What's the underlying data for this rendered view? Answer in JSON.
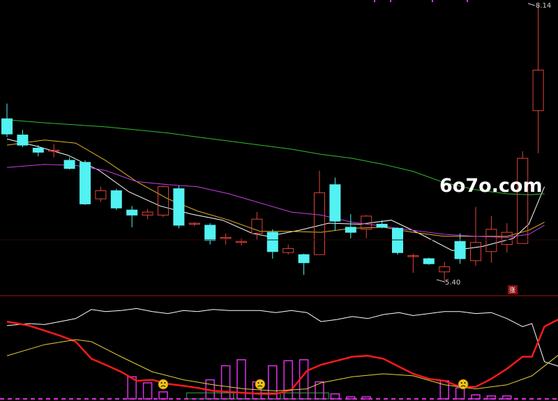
{
  "watermark": "6o7o.com",
  "price_labels": {
    "high": "8.14",
    "low": "5.40"
  },
  "limit_badge": "涨",
  "colors": {
    "background": "#000000",
    "up": "#e0433a",
    "down": "#52f2f2",
    "ma5": "#ffffff",
    "ma10": "#e6b422",
    "ma30": "#c83ee8",
    "ma60": "#2fbf2f",
    "divider": "#b01010",
    "osc_white": "#ffffff",
    "osc_red": "#ff1a1a",
    "osc_yellow": "#e6d23a",
    "bar_magenta": "#e030e8",
    "bar_green": "#3aa04a",
    "face": "#f2c316"
  },
  "chart_data": [
    {
      "type": "candlestick",
      "y_range_estimated": [
        5.1,
        8.3
      ],
      "candles": [
        {
          "o": 7.02,
          "h": 7.17,
          "l": 6.84,
          "c": 6.87
        },
        {
          "o": 6.86,
          "h": 6.91,
          "l": 6.74,
          "c": 6.76
        },
        {
          "o": 6.73,
          "h": 6.76,
          "l": 6.65,
          "c": 6.69
        },
        {
          "o": 6.71,
          "h": 6.77,
          "l": 6.64,
          "c": 6.71
        },
        {
          "o": 6.61,
          "h": 6.64,
          "l": 6.52,
          "c": 6.53
        },
        {
          "o": 6.59,
          "h": 6.61,
          "l": 6.17,
          "c": 6.18
        },
        {
          "o": 6.23,
          "h": 6.35,
          "l": 6.2,
          "c": 6.31
        },
        {
          "o": 6.31,
          "h": 6.33,
          "l": 6.12,
          "c": 6.14
        },
        {
          "o": 6.12,
          "h": 6.16,
          "l": 5.95,
          "c": 6.07
        },
        {
          "o": 6.07,
          "h": 6.13,
          "l": 6.03,
          "c": 6.1
        },
        {
          "o": 6.07,
          "h": 6.36,
          "l": 6.05,
          "c": 6.35
        },
        {
          "o": 6.33,
          "h": 6.36,
          "l": 5.94,
          "c": 5.97
        },
        {
          "o": 5.99,
          "h": 6.0,
          "l": 5.96,
          "c": 5.99
        },
        {
          "o": 5.97,
          "h": 5.99,
          "l": 5.78,
          "c": 5.82
        },
        {
          "o": 5.84,
          "h": 5.89,
          "l": 5.78,
          "c": 5.85
        },
        {
          "o": 5.8,
          "h": 5.84,
          "l": 5.77,
          "c": 5.81
        },
        {
          "o": 5.89,
          "h": 6.1,
          "l": 5.83,
          "c": 6.03
        },
        {
          "o": 5.9,
          "h": 5.93,
          "l": 5.64,
          "c": 5.71
        },
        {
          "o": 5.7,
          "h": 5.78,
          "l": 5.68,
          "c": 5.74
        },
        {
          "o": 5.68,
          "h": 5.69,
          "l": 5.48,
          "c": 5.6
        },
        {
          "o": 5.68,
          "h": 6.51,
          "l": 5.68,
          "c": 6.29
        },
        {
          "o": 6.37,
          "h": 6.44,
          "l": 5.92,
          "c": 6.01
        },
        {
          "o": 5.95,
          "h": 6.08,
          "l": 5.84,
          "c": 5.9
        },
        {
          "o": 5.93,
          "h": 6.07,
          "l": 5.84,
          "c": 6.06
        },
        {
          "o": 5.98,
          "h": 6.02,
          "l": 5.94,
          "c": 5.95
        },
        {
          "o": 5.94,
          "h": 5.95,
          "l": 5.68,
          "c": 5.7
        },
        {
          "o": 5.67,
          "h": 5.69,
          "l": 5.5,
          "c": 5.67
        },
        {
          "o": 5.64,
          "h": 5.65,
          "l": 5.58,
          "c": 5.59
        },
        {
          "o": 5.51,
          "h": 5.61,
          "l": 5.4,
          "c": 5.56
        },
        {
          "o": 5.81,
          "h": 5.89,
          "l": 5.59,
          "c": 5.64
        },
        {
          "o": 5.62,
          "h": 6.15,
          "l": 5.57,
          "c": 5.8
        },
        {
          "o": 5.71,
          "h": 6.06,
          "l": 5.6,
          "c": 5.93
        },
        {
          "o": 5.78,
          "h": 5.99,
          "l": 5.7,
          "c": 5.9
        },
        {
          "o": 5.79,
          "h": 6.7,
          "l": 5.79,
          "c": 6.63
        },
        {
          "o": 7.1,
          "h": 8.14,
          "l": 6.68,
          "c": 7.5
        }
      ],
      "ma": [
        {
          "name": "MA5",
          "points": [
            [
              0,
              6.82
            ],
            [
              1.9,
              6.75
            ],
            [
              3.9,
              6.66
            ],
            [
              5.9,
              6.51
            ],
            [
              7.8,
              6.3
            ],
            [
              9.8,
              6.16
            ],
            [
              11.8,
              6.08
            ],
            [
              13.8,
              6.02
            ],
            [
              15.7,
              5.89
            ],
            [
              16.7,
              5.86
            ],
            [
              18.7,
              5.92
            ],
            [
              20.6,
              5.99
            ],
            [
              22.6,
              5.98
            ],
            [
              24.6,
              6.02
            ],
            [
              26.5,
              5.88
            ],
            [
              28.5,
              5.72
            ],
            [
              30.4,
              5.76
            ],
            [
              32.4,
              5.84
            ],
            [
              33.4,
              5.98
            ],
            [
              34.4,
              6.35
            ]
          ]
        },
        {
          "name": "MA10",
          "points": [
            [
              0,
              6.76
            ],
            [
              2.4,
              6.81
            ],
            [
              4.4,
              6.78
            ],
            [
              6.3,
              6.61
            ],
            [
              8.3,
              6.4
            ],
            [
              10.3,
              6.23
            ],
            [
              12.2,
              6.11
            ],
            [
              14.2,
              6.02
            ],
            [
              16.2,
              5.91
            ],
            [
              18.2,
              5.91
            ],
            [
              20.1,
              5.9
            ],
            [
              22.1,
              5.94
            ],
            [
              24.1,
              5.95
            ],
            [
              26.0,
              5.9
            ],
            [
              28.0,
              5.86
            ],
            [
              30.0,
              5.86
            ],
            [
              32.0,
              5.86
            ],
            [
              33.4,
              5.92
            ],
            [
              34.4,
              6.0
            ]
          ]
        },
        {
          "name": "MA30",
          "points": [
            [
              0,
              6.54
            ],
            [
              2.4,
              6.57
            ],
            [
              4.4,
              6.56
            ],
            [
              6.3,
              6.51
            ],
            [
              8.3,
              6.4
            ],
            [
              10.3,
              6.37
            ],
            [
              12.2,
              6.35
            ],
            [
              14.2,
              6.28
            ],
            [
              16.2,
              6.19
            ],
            [
              18.2,
              6.1
            ],
            [
              20.1,
              6.07
            ],
            [
              22.1,
              6.0
            ],
            [
              24.1,
              5.96
            ],
            [
              26.0,
              5.92
            ],
            [
              28.0,
              5.88
            ],
            [
              30.0,
              5.86
            ],
            [
              32.0,
              5.85
            ],
            [
              33.4,
              5.88
            ],
            [
              34.4,
              5.97
            ]
          ]
        },
        {
          "name": "MA60",
          "points": [
            [
              0,
              7.01
            ],
            [
              2.4,
              6.98
            ],
            [
              4.4,
              6.96
            ],
            [
              6.3,
              6.94
            ],
            [
              8.3,
              6.91
            ],
            [
              10.3,
              6.88
            ],
            [
              12.2,
              6.84
            ],
            [
              14.2,
              6.8
            ],
            [
              16.2,
              6.76
            ],
            [
              18.2,
              6.72
            ],
            [
              20.1,
              6.67
            ],
            [
              22.1,
              6.63
            ],
            [
              24.1,
              6.57
            ],
            [
              26.0,
              6.5
            ],
            [
              28.0,
              6.39
            ],
            [
              30.0,
              6.32
            ],
            [
              32.0,
              6.28
            ],
            [
              33.4,
              6.27
            ],
            [
              34.4,
              6.28
            ]
          ]
        }
      ]
    },
    {
      "type": "line",
      "y_range_estimated": [
        0,
        100
      ],
      "series": [
        {
          "points": [
            [
              0,
              73
            ],
            [
              1.4,
              75
            ],
            [
              2.4,
              74
            ],
            [
              3.4,
              77
            ],
            [
              4.4,
              80
            ],
            [
              5.4,
              89
            ],
            [
              6.3,
              87
            ],
            [
              7.3,
              88
            ],
            [
              8.3,
              90
            ],
            [
              9.3,
              87
            ],
            [
              10.3,
              85
            ],
            [
              11.3,
              88
            ],
            [
              12.2,
              87
            ],
            [
              13.2,
              89
            ],
            [
              14.2,
              88
            ],
            [
              15.2,
              88
            ],
            [
              16.2,
              88
            ],
            [
              17.2,
              86
            ],
            [
              18.2,
              88
            ],
            [
              19.2,
              86
            ],
            [
              20.1,
              77
            ],
            [
              21.1,
              79
            ],
            [
              22.1,
              82
            ],
            [
              23.1,
              80
            ],
            [
              24.1,
              84
            ],
            [
              25.1,
              86
            ],
            [
              26.0,
              83
            ],
            [
              27.0,
              85
            ],
            [
              28.0,
              87
            ],
            [
              29.0,
              87
            ],
            [
              30.0,
              85
            ],
            [
              31.0,
              86
            ],
            [
              32.0,
              80
            ],
            [
              33.0,
              72
            ],
            [
              33.6,
              75
            ],
            [
              34.4,
              37
            ],
            [
              35.4,
              32
            ]
          ]
        },
        {
          "points": [
            [
              0,
              77
            ],
            [
              1.4,
              73
            ],
            [
              2.4,
              68
            ],
            [
              3.4,
              63
            ],
            [
              4.4,
              57
            ],
            [
              5.4,
              40
            ],
            [
              6.3,
              34
            ],
            [
              7.3,
              27
            ],
            [
              8.3,
              18
            ],
            [
              9.3,
              19
            ],
            [
              10.3,
              15
            ],
            [
              11.3,
              13
            ],
            [
              12.2,
              11
            ],
            [
              13.2,
              8
            ],
            [
              14.2,
              7
            ],
            [
              15.2,
              6
            ],
            [
              16.2,
              5
            ],
            [
              17.2,
              5
            ],
            [
              18.2,
              9
            ],
            [
              19.2,
              28
            ],
            [
              20.1,
              34
            ],
            [
              21.1,
              38
            ],
            [
              22.1,
              42
            ],
            [
              23.1,
              43
            ],
            [
              24.1,
              40
            ],
            [
              25.1,
              32
            ],
            [
              26.0,
              25
            ],
            [
              27.0,
              20
            ],
            [
              28.0,
              18
            ],
            [
              29.0,
              12
            ],
            [
              30.0,
              12
            ],
            [
              31.0,
              20
            ],
            [
              32.0,
              30
            ],
            [
              33.0,
              42
            ],
            [
              33.6,
              42
            ],
            [
              34.4,
              72
            ],
            [
              35.4,
              80
            ]
          ]
        },
        {
          "points": [
            [
              0,
              43
            ],
            [
              2.4,
              54
            ],
            [
              4.4,
              59
            ],
            [
              5.4,
              57
            ],
            [
              7.3,
              42
            ],
            [
              9.3,
              27
            ],
            [
              11.3,
              19
            ],
            [
              13.2,
              14
            ],
            [
              15.2,
              10
            ],
            [
              17.2,
              8
            ],
            [
              19.2,
              10
            ],
            [
              20.1,
              16
            ],
            [
              22.1,
              22
            ],
            [
              24.1,
              25
            ],
            [
              26.0,
              23
            ],
            [
              28.0,
              14
            ],
            [
              30.0,
              10
            ],
            [
              32.0,
              14
            ],
            [
              33.6,
              23
            ],
            [
              35.4,
              45
            ]
          ]
        }
      ],
      "bars": [
        {
          "i": 8,
          "v": 22,
          "color": "magenta"
        },
        {
          "i": 9,
          "v": 16,
          "color": "magenta"
        },
        {
          "i": 10,
          "v": 7,
          "color": "magenta"
        },
        {
          "i": 13,
          "v": 19,
          "color": "magenta"
        },
        {
          "i": 14,
          "v": 33,
          "color": "magenta"
        },
        {
          "i": 15,
          "v": 39,
          "color": "magenta"
        },
        {
          "i": 16,
          "v": 17,
          "color": "magenta"
        },
        {
          "i": 17,
          "v": 33,
          "color": "magenta"
        },
        {
          "i": 18,
          "v": 38,
          "color": "magenta"
        },
        {
          "i": 19,
          "v": 39,
          "color": "magenta"
        },
        {
          "i": 20,
          "v": 17,
          "color": "magenta"
        },
        {
          "i": 21,
          "v": 5,
          "color": "magenta"
        },
        {
          "i": 22,
          "v": 2,
          "color": "magenta"
        },
        {
          "i": 23,
          "v": 2,
          "color": "magenta"
        },
        {
          "i": 28,
          "v": 18,
          "color": "magenta"
        },
        {
          "i": 29,
          "v": 11,
          "color": "magenta"
        },
        {
          "i": 30,
          "v": 4,
          "color": "magenta"
        },
        {
          "i": 31,
          "v": 3,
          "color": "magenta"
        },
        {
          "i": 32,
          "v": 3,
          "color": "magenta"
        }
      ],
      "green_boxes": [
        [
          11.5,
          14.5
        ],
        [
          14.5,
          17.5
        ],
        [
          17.5,
          20.6
        ]
      ],
      "faces": [
        10,
        16.2,
        29.2
      ]
    }
  ]
}
